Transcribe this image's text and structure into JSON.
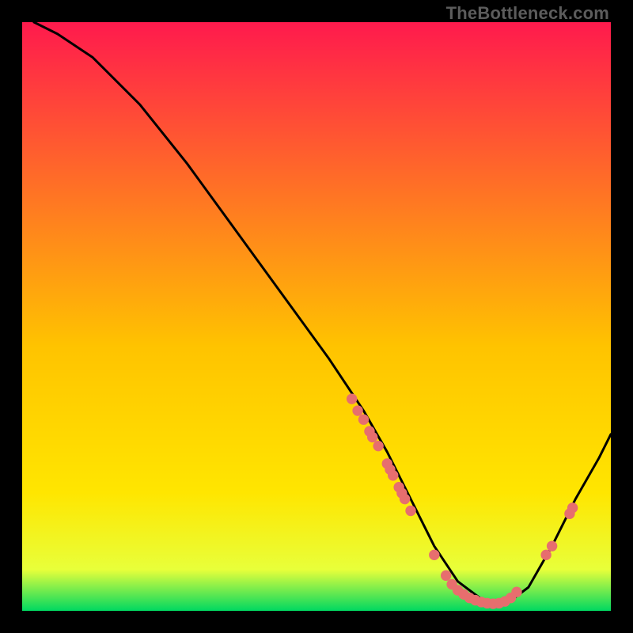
{
  "watermark": "TheBottleneck.com",
  "chart_data": {
    "type": "line",
    "title": "",
    "xlabel": "",
    "ylabel": "",
    "xlim": [
      0,
      100
    ],
    "ylim": [
      0,
      100
    ],
    "grid": false,
    "legend": false,
    "background_gradient": {
      "top": "#ff1a4d",
      "mid": "#ffe600",
      "bottom": "#00d861"
    },
    "series": [
      {
        "name": "bottleneck-curve",
        "color": "#000000",
        "x": [
          2,
          6,
          12,
          20,
          28,
          36,
          44,
          52,
          58,
          62,
          66,
          70,
          74,
          78,
          82,
          86,
          90,
          94,
          98,
          100
        ],
        "y": [
          100,
          98,
          94,
          86,
          76,
          65,
          54,
          43,
          34,
          27,
          19,
          11,
          5,
          2,
          1,
          4,
          11,
          19,
          26,
          30
        ]
      }
    ],
    "markers": {
      "name": "sample-points",
      "color": "#e76e6e",
      "radius_pct": 0.9,
      "points": [
        {
          "x": 56,
          "y": 36
        },
        {
          "x": 57,
          "y": 34
        },
        {
          "x": 58,
          "y": 32.5
        },
        {
          "x": 59,
          "y": 30.5
        },
        {
          "x": 59.5,
          "y": 29.5
        },
        {
          "x": 60.5,
          "y": 28
        },
        {
          "x": 62,
          "y": 25
        },
        {
          "x": 62.5,
          "y": 24
        },
        {
          "x": 63,
          "y": 23
        },
        {
          "x": 64,
          "y": 21
        },
        {
          "x": 64.5,
          "y": 20
        },
        {
          "x": 65,
          "y": 19
        },
        {
          "x": 66,
          "y": 17
        },
        {
          "x": 70,
          "y": 9.5
        },
        {
          "x": 72,
          "y": 6
        },
        {
          "x": 73,
          "y": 4.5
        },
        {
          "x": 74,
          "y": 3.5
        },
        {
          "x": 75,
          "y": 2.8
        },
        {
          "x": 76,
          "y": 2.2
        },
        {
          "x": 77,
          "y": 1.8
        },
        {
          "x": 78,
          "y": 1.5
        },
        {
          "x": 79,
          "y": 1.3
        },
        {
          "x": 80,
          "y": 1.2
        },
        {
          "x": 81,
          "y": 1.3
        },
        {
          "x": 82,
          "y": 1.6
        },
        {
          "x": 83,
          "y": 2.2
        },
        {
          "x": 84,
          "y": 3.2
        },
        {
          "x": 89,
          "y": 9.5
        },
        {
          "x": 90,
          "y": 11
        },
        {
          "x": 93,
          "y": 16.5
        },
        {
          "x": 93.5,
          "y": 17.5
        }
      ]
    }
  }
}
